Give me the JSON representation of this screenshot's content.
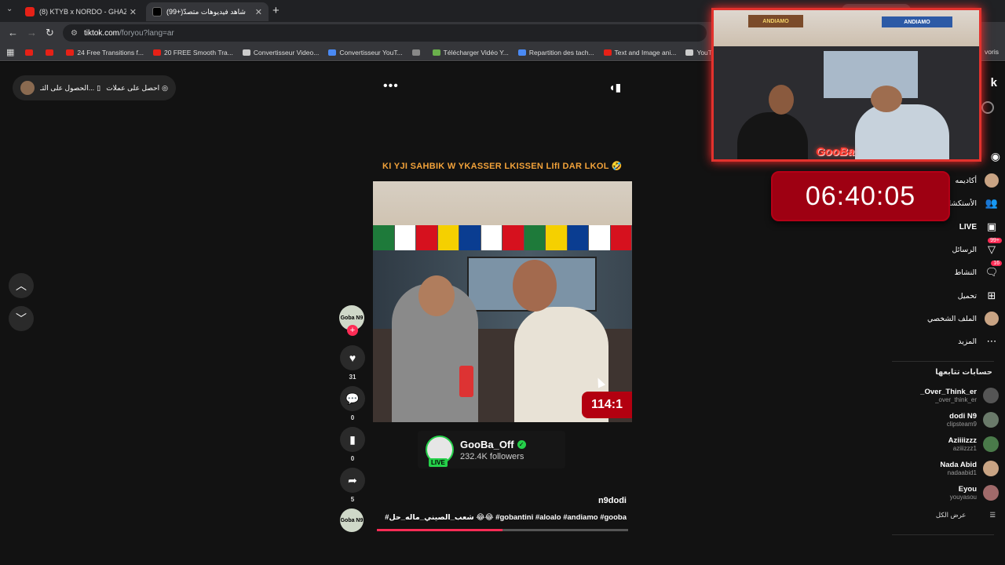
{
  "browser": {
    "tabs": [
      {
        "title": "(8) KTYB x NORDO - GHAZALI (",
        "favicon_color": "#e62117",
        "active": false
      },
      {
        "title": "(99+)شاهد فيديوهات متصدّ",
        "favicon_color": "#000000",
        "active": true
      }
    ],
    "new_tab": "+",
    "close": "✕",
    "url_host": "tiktok.com",
    "url_path": "/foryou?lang=ar",
    "gemini_label": "Demander à Gemini",
    "bookmarks": [
      {
        "label": "",
        "color": "#e62117"
      },
      {
        "label": "",
        "color": "#e62117"
      },
      {
        "label": "24 Free Transitions f...",
        "color": "#e62117"
      },
      {
        "label": "20 FREE Smooth Tra...",
        "color": "#e62117"
      },
      {
        "label": "Convertisseur Video...",
        "color": "#cccccc"
      },
      {
        "label": "Convertisseur YouT...",
        "color": "#4a8af4"
      },
      {
        "label": "",
        "color": "#888888"
      },
      {
        "label": "Télécharger Vidéo Y...",
        "color": "#6ab04c"
      },
      {
        "label": "Repartition des tach...",
        "color": "#4a8af4"
      },
      {
        "label": "Text and Image ani...",
        "color": "#e62117"
      },
      {
        "label": "YouTube Converter ...",
        "color": "#cccccc"
      }
    ],
    "bookmarks_right": "voris"
  },
  "page": {
    "pill": {
      "item1": "الحصول على التـ...",
      "item2": "احصل على عملات"
    },
    "more": "•••",
    "video": {
      "caption": "KI YJI SAHBIK W YKASSER LKISSEN LIfI DAR LKOL 🤣",
      "flag_colors": [
        "#1e7a3a",
        "#ffffff",
        "#d6111e",
        "#f5d000",
        "#0a3d91",
        "#ffffff",
        "#d6111e",
        "#1e7a3a",
        "#f5d000",
        "#0a3d91",
        "#ffffff",
        "#d6111e"
      ],
      "counter": "114:1",
      "progress": 0.5
    },
    "live_card": {
      "name": "GooBa_Off",
      "followers": "232.4K followers",
      "badge": "LIVE"
    },
    "author": "n9dodi",
    "description": "#شعب_الصيني_ماله_حل 😂😂 #gobantini #aloalo #andiamo #gooba",
    "actions": {
      "avatar_text": "Goba N9",
      "likes": "31",
      "comments": "0",
      "saves": "0",
      "shares": "5",
      "disc_text": "Goba N9"
    }
  },
  "sidebar": {
    "top_letter": "k",
    "nav": [
      {
        "label": "أكاديمه",
        "icon": "avatar",
        "badge": ""
      },
      {
        "label": "الأستكشاف",
        "icon": "users",
        "badge": ""
      },
      {
        "label": "LIVE",
        "icon": "live",
        "badge": ""
      },
      {
        "label": "الرسائل",
        "icon": "inbox",
        "badge": "99+"
      },
      {
        "label": "النشاط",
        "icon": "activity",
        "badge": "16"
      },
      {
        "label": "تحميل",
        "icon": "upload",
        "badge": ""
      },
      {
        "label": "الملف الشخصي",
        "icon": "avatar",
        "badge": ""
      },
      {
        "label": "المزيد",
        "icon": "more",
        "badge": ""
      }
    ],
    "following_heading": "حسابات تتابعها",
    "following": [
      {
        "name": "_Over_Think_er",
        "user": "_over_think_er",
        "color": "#555555"
      },
      {
        "name": "dodi N9",
        "user": "clipsteam9",
        "color": "#6a7a6a"
      },
      {
        "name": "Aziiiizzz",
        "user": "aziiizzz1",
        "color": "#4a7a4a"
      },
      {
        "name": "Nada Abid",
        "user": "nadaabid1",
        "color": "#c9a484"
      },
      {
        "name": "Eyou",
        "user": "youyasou",
        "color": "#a06a6a"
      }
    ],
    "see_all": "عرض الكل"
  },
  "overlay": {
    "timer": "06:40:05",
    "logo": "GooBa",
    "banner_left": "ANDIAMO",
    "banner_right": "ANDIAMO"
  }
}
